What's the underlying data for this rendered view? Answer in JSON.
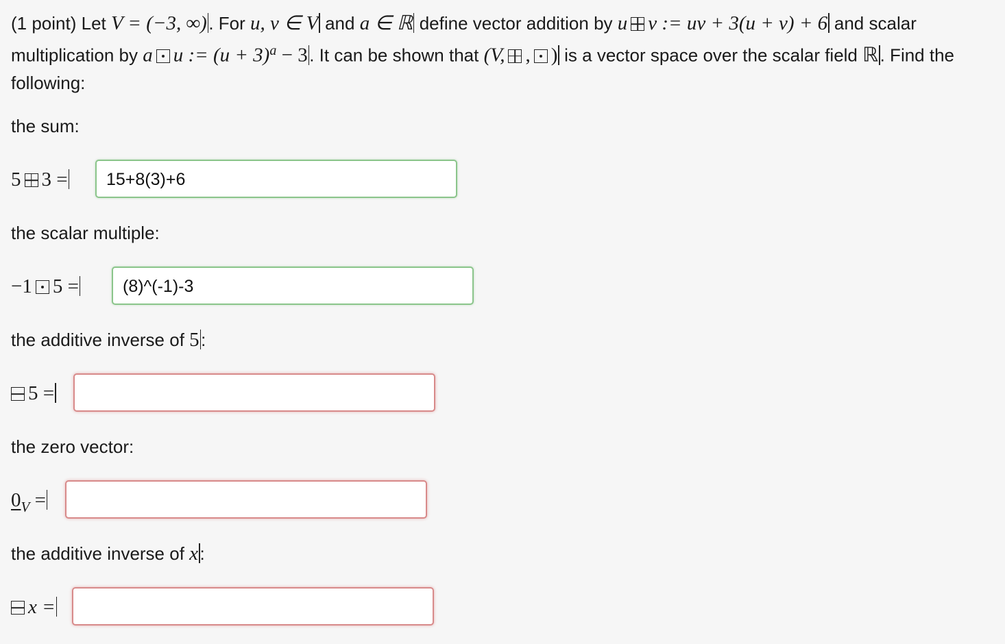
{
  "problem": {
    "points": "(1 point) Let",
    "V_def": "V = (−3, ∞)",
    "t1": ". For",
    "uv_in_V": "u, v ∈ V",
    "t2": "and",
    "a_in_R": "a ∈ ℝ",
    "t3": "define vector addition by",
    "u": "u",
    "add_rhs": "v := uv + 3(u + v) + 6",
    "t4": "and scalar multiplication by",
    "a": "a",
    "mul_rhs": "u := (u + 3)",
    "exp_a": "a",
    "mul_tail": " − 3",
    "t5": ". It can be shown that",
    "tuple_open": "(V,",
    "comma": ",",
    "tuple_close": ")",
    "t6": "is a vector space over the scalar field",
    "R": "ℝ",
    "t7": ". Find the following:"
  },
  "q1": {
    "label": "the sum:",
    "a": "5",
    "b": "3 =",
    "value": "15+8(3)+6"
  },
  "q2": {
    "label": "the scalar multiple:",
    "a": "−1",
    "b": "5 =",
    "value": "(8)^(-1)-3"
  },
  "q3": {
    "label": "the additive inverse of",
    "var": "5",
    "colon": ":",
    "b": "5 =",
    "value": ""
  },
  "q4": {
    "label": "the zero vector:",
    "zero": "0",
    "sub": "V",
    "eq": " =",
    "value": ""
  },
  "q5": {
    "label": "the additive inverse of",
    "var": "x",
    "colon": ":",
    "b": "x =",
    "value": ""
  },
  "colors": {
    "correct_border": "#8bc58b",
    "incorrect_border": "#d88a8a",
    "background": "#f6f6f6"
  },
  "icons": [
    "box-plus-operator-icon",
    "box-dot-operator-icon",
    "box-minus-operator-icon"
  ]
}
